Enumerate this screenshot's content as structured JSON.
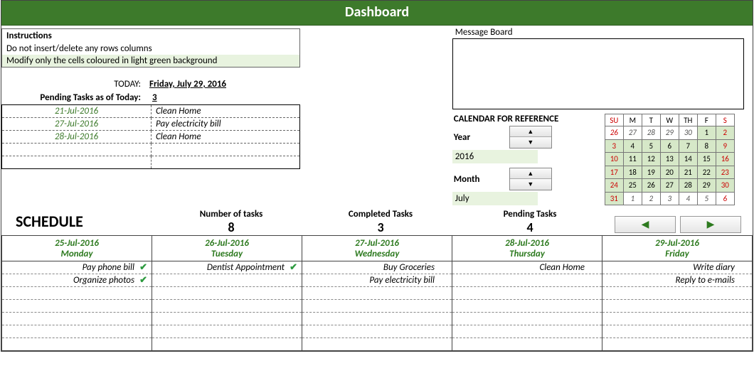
{
  "title": "Dashboard",
  "instructions": {
    "header": "Instructions",
    "line1": "Do not insert/delete any rows columns",
    "line2": "Modify only the cells coloured in light green background"
  },
  "today": {
    "label": "TODAY:",
    "value": "Friday, July 29, 2016"
  },
  "pending": {
    "label": "Pending Tasks as of Today:",
    "count": "3",
    "tasks": [
      {
        "date": "21-Jul-2016",
        "name": "Clean Home"
      },
      {
        "date": "27-Jul-2016",
        "name": "Pay electricity bill"
      },
      {
        "date": "28-Jul-2016",
        "name": "Clean Home"
      }
    ]
  },
  "message_board": {
    "label": "Message Board",
    "content": ""
  },
  "calendar_ref": {
    "title": "CALENDAR FOR REFERENCE",
    "year_label": "Year",
    "year_value": "2016",
    "month_label": "Month",
    "month_value": "July",
    "dow": [
      "SU",
      "M",
      "T",
      "W",
      "TH",
      "F",
      "S"
    ],
    "weeks": [
      [
        {
          "n": "26",
          "in": false,
          "we": true
        },
        {
          "n": "27",
          "in": false
        },
        {
          "n": "28",
          "in": false
        },
        {
          "n": "29",
          "in": false
        },
        {
          "n": "30",
          "in": false
        },
        {
          "n": "1",
          "in": true
        },
        {
          "n": "2",
          "in": true,
          "we": true
        }
      ],
      [
        {
          "n": "3",
          "in": true,
          "we": true
        },
        {
          "n": "4",
          "in": true
        },
        {
          "n": "5",
          "in": true
        },
        {
          "n": "6",
          "in": true
        },
        {
          "n": "7",
          "in": true
        },
        {
          "n": "8",
          "in": true
        },
        {
          "n": "9",
          "in": true,
          "we": true
        }
      ],
      [
        {
          "n": "10",
          "in": true,
          "we": true
        },
        {
          "n": "11",
          "in": true
        },
        {
          "n": "12",
          "in": true
        },
        {
          "n": "13",
          "in": true
        },
        {
          "n": "14",
          "in": true
        },
        {
          "n": "15",
          "in": true
        },
        {
          "n": "16",
          "in": true,
          "we": true
        }
      ],
      [
        {
          "n": "17",
          "in": true,
          "we": true
        },
        {
          "n": "18",
          "in": true
        },
        {
          "n": "19",
          "in": true
        },
        {
          "n": "20",
          "in": true
        },
        {
          "n": "21",
          "in": true
        },
        {
          "n": "22",
          "in": true
        },
        {
          "n": "23",
          "in": true,
          "we": true
        }
      ],
      [
        {
          "n": "24",
          "in": true,
          "we": true
        },
        {
          "n": "25",
          "in": true
        },
        {
          "n": "26",
          "in": true
        },
        {
          "n": "27",
          "in": true
        },
        {
          "n": "28",
          "in": true
        },
        {
          "n": "29",
          "in": true
        },
        {
          "n": "30",
          "in": true,
          "we": true
        }
      ],
      [
        {
          "n": "31",
          "in": true,
          "we": true
        },
        {
          "n": "1",
          "in": false
        },
        {
          "n": "2",
          "in": false
        },
        {
          "n": "3",
          "in": false
        },
        {
          "n": "4",
          "in": false
        },
        {
          "n": "5",
          "in": false
        },
        {
          "n": "6",
          "in": false,
          "we": true
        }
      ]
    ]
  },
  "schedule": {
    "title": "SCHEDULE",
    "stats": {
      "num_label": "Number of tasks",
      "num_value": "8",
      "comp_label": "Completed Tasks",
      "comp_value": "3",
      "pend_label": "Pending Tasks",
      "pend_value": "4"
    },
    "days": [
      {
        "date": "25-Jul-2016",
        "dow": "Monday",
        "tasks": [
          {
            "t": "Pay phone bill",
            "done": true
          },
          {
            "t": "Organize photos",
            "done": true
          }
        ]
      },
      {
        "date": "26-Jul-2016",
        "dow": "Tuesday",
        "tasks": [
          {
            "t": "Dentist Appointment",
            "done": true
          }
        ]
      },
      {
        "date": "27-Jul-2016",
        "dow": "Wednesday",
        "tasks": [
          {
            "t": "Buy Groceries",
            "done": false
          },
          {
            "t": "Pay electricity bill",
            "done": false
          }
        ]
      },
      {
        "date": "28-Jul-2016",
        "dow": "Thursday",
        "tasks": [
          {
            "t": "Clean Home",
            "done": false
          }
        ]
      },
      {
        "date": "29-Jul-2016",
        "dow": "Friday",
        "tasks": [
          {
            "t": "Write diary",
            "done": false
          },
          {
            "t": "Reply to e-mails",
            "done": false
          }
        ]
      }
    ],
    "rows_per_day": 7
  }
}
